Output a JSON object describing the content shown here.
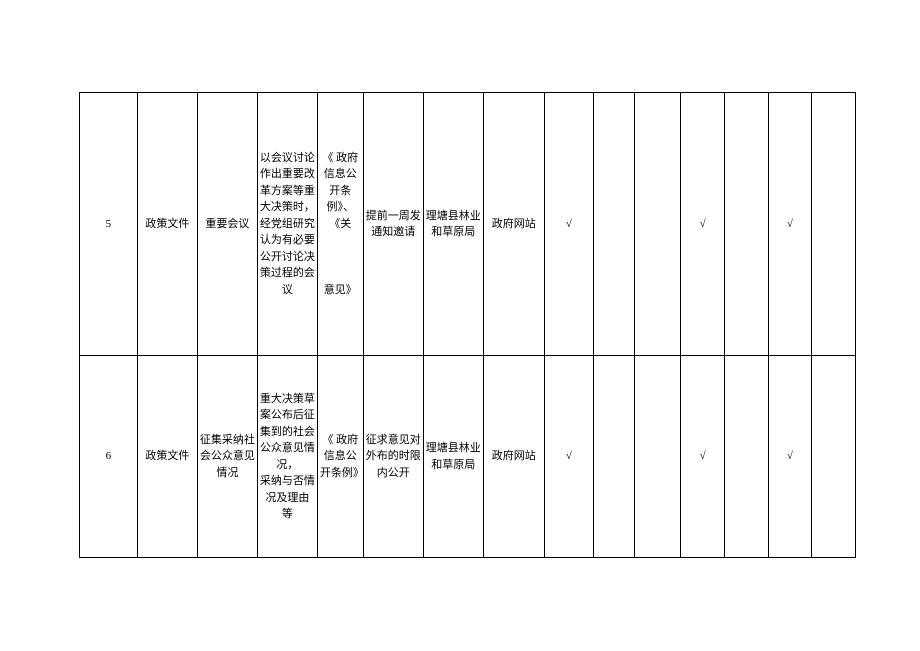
{
  "rows": [
    {
      "num": "5",
      "category": "政策文件",
      "type": "重要会议",
      "content": "以会议讨论作出重要改革方案等重大决策时，经党组研究认为有必要公开讨论决策过程的会议",
      "basis": "《 政府信息公开条例》、《关\n\n\n\n意见》",
      "timing": "提前一周发通知邀请",
      "subject": "理塘县林业和草原局",
      "channel": "政府网站",
      "chk1": "√",
      "chk2": "",
      "chk3": "",
      "chk4": "√",
      "chk5": "",
      "chk6": "√",
      "chk7": ""
    },
    {
      "num": "6",
      "category": "政策文件",
      "type": "征集采纳社会公众意见情况",
      "content": "重大决策草案公布后征集到的社会公众意见情况，\n采纳与否情况及理由\n等",
      "basis": "《 政府信息公开条例》",
      "timing": "征求意见对外布的时限内公开",
      "subject": "理塘县林业和草原局",
      "channel": "政府网站",
      "chk1": "√",
      "chk2": "",
      "chk3": "",
      "chk4": "√",
      "chk5": "",
      "chk6": "√",
      "chk7": ""
    }
  ]
}
